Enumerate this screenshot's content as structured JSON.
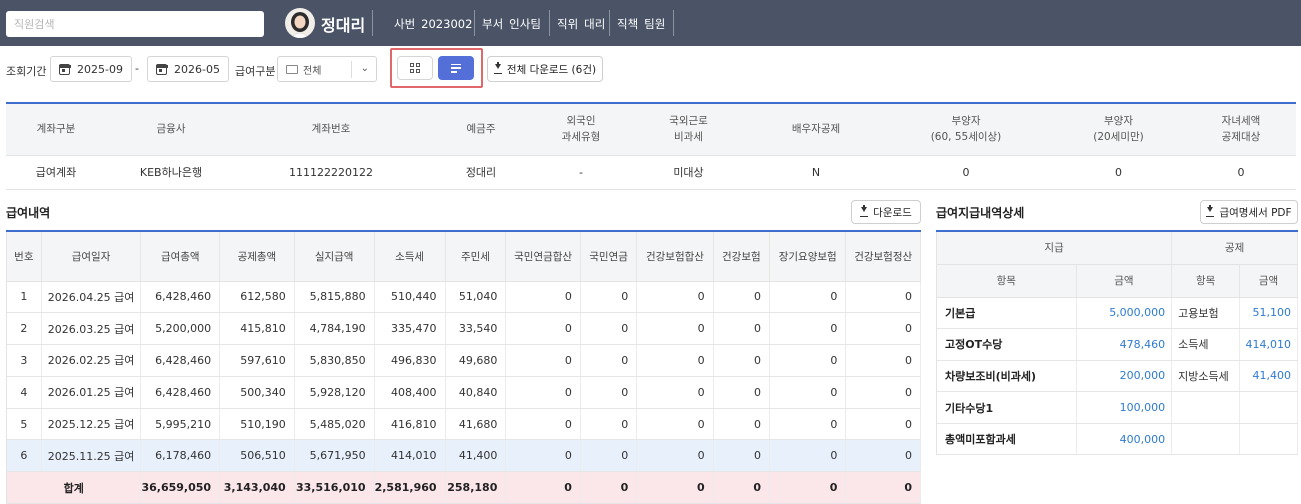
{
  "header": {
    "search_placeholder": "직원검색",
    "user_name": "정대리",
    "info": [
      {
        "key": "사번",
        "value": "2023002"
      },
      {
        "key": "부서",
        "value": "인사팀"
      },
      {
        "key": "직위",
        "value": "대리"
      },
      {
        "key": "직책",
        "value": "팀원"
      }
    ]
  },
  "filters": {
    "period_label": "조회기간",
    "start": "2025-09",
    "separator": "-",
    "end": "2026-05",
    "pay_type_label": "급여구분",
    "pay_type_value": "전체",
    "download_all_label": "전체 다운로드 (6건)"
  },
  "account": {
    "headers": [
      [
        "계좌구분"
      ],
      [
        "금융사"
      ],
      [
        "계좌번호"
      ],
      [
        "예금주"
      ],
      [
        "외국인",
        "과세유형"
      ],
      [
        "국외근로",
        "비과세"
      ],
      [
        "배우자공제"
      ],
      [
        "부양자",
        "(60, 55세이상)"
      ],
      [
        "부양자",
        "(20세미만)"
      ],
      [
        "자녀세액",
        "공제대상"
      ]
    ],
    "row": [
      "급여계좌",
      "KEB하나은행",
      "111122220122",
      "정대리",
      "-",
      "미대상",
      "N",
      "0",
      "0",
      "0"
    ]
  },
  "pay": {
    "title": "급여내역",
    "download_label": "다운로드",
    "headers": [
      "번호",
      "급여일자",
      "급여총액",
      "공제총액",
      "실지급액",
      "소득세",
      "주민세",
      "국민연금합산",
      "국민연금",
      "건강보험합산",
      "건강보험",
      "장기요양보험",
      "건강보험정산"
    ],
    "rows": [
      [
        "1",
        "2026.04.25 급여",
        "6,428,460",
        "612,580",
        "5,815,880",
        "510,440",
        "51,040",
        "0",
        "0",
        "0",
        "0",
        "0",
        "0"
      ],
      [
        "2",
        "2026.03.25 급여",
        "5,200,000",
        "415,810",
        "4,784,190",
        "335,470",
        "33,540",
        "0",
        "0",
        "0",
        "0",
        "0",
        "0"
      ],
      [
        "3",
        "2026.02.25 급여",
        "6,428,460",
        "597,610",
        "5,830,850",
        "496,830",
        "49,680",
        "0",
        "0",
        "0",
        "0",
        "0",
        "0"
      ],
      [
        "4",
        "2026.01.25 급여",
        "6,428,460",
        "500,340",
        "5,928,120",
        "408,400",
        "40,840",
        "0",
        "0",
        "0",
        "0",
        "0",
        "0"
      ],
      [
        "5",
        "2025.12.25 급여",
        "5,995,210",
        "510,190",
        "5,485,020",
        "416,810",
        "41,680",
        "0",
        "0",
        "0",
        "0",
        "0",
        "0"
      ],
      [
        "6",
        "2025.11.25 급여",
        "6,178,460",
        "506,510",
        "5,671,950",
        "414,010",
        "41,400",
        "0",
        "0",
        "0",
        "0",
        "0",
        "0"
      ]
    ],
    "selected_index": 5,
    "total": [
      "합계",
      "36,659,050",
      "3,143,040",
      "33,516,010",
      "2,581,960",
      "258,180",
      "0",
      "0",
      "0",
      "0",
      "0",
      "0"
    ]
  },
  "detail": {
    "title": "급여지급내역상세",
    "download_label": "급여명세서 PDF",
    "group_pay": "지급",
    "group_deduct": "공제",
    "col_item": "항목",
    "col_amount": "금액",
    "rows": [
      {
        "pay_item": "기본급",
        "pay_amount": "5,000,000",
        "ded_item": "고용보험",
        "ded_amount": "51,100"
      },
      {
        "pay_item": "고정OT수당",
        "pay_amount": "478,460",
        "ded_item": "소득세",
        "ded_amount": "414,010"
      },
      {
        "pay_item": "차량보조비(비과세)",
        "pay_amount": "200,000",
        "ded_item": "지방소득세",
        "ded_amount": "41,400"
      },
      {
        "pay_item": "기타수당1",
        "pay_amount": "100,000",
        "ded_item": "",
        "ded_amount": ""
      },
      {
        "pay_item": "총액미포함과세",
        "pay_amount": "400,000",
        "ded_item": "",
        "ded_amount": ""
      }
    ]
  },
  "colors": {
    "header_bg": "#4a5466",
    "accent": "#3e6fd0",
    "active_toggle": "#5470d8",
    "highlight_border": "#e06868",
    "amount_text": "#2f7bd1",
    "selected_row": "#e8f0fc",
    "total_row": "#fbe6e9"
  },
  "icons": [
    "avatar",
    "calendar-icon",
    "wallet-icon",
    "chevron-down-icon",
    "grid-view-icon",
    "list-view-icon",
    "download-icon"
  ]
}
